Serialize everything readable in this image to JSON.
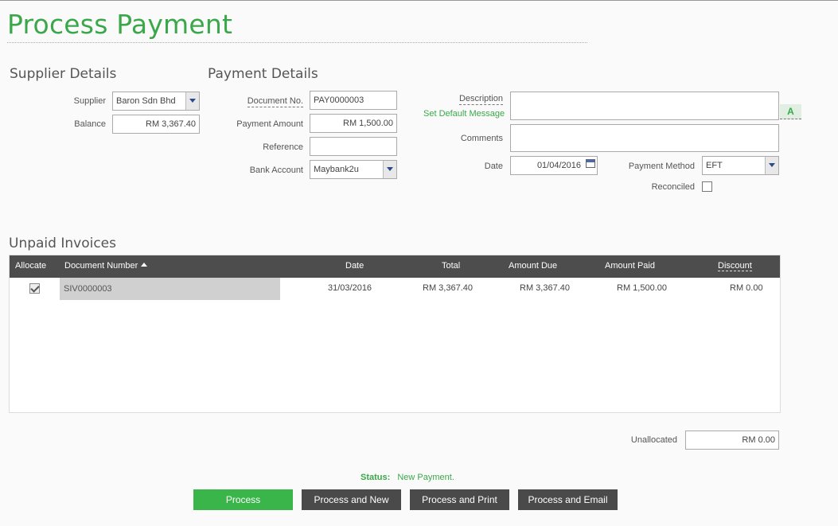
{
  "page": {
    "title": "Process Payment"
  },
  "supplier": {
    "heading": "Supplier Details",
    "supplier_label": "Supplier",
    "supplier_value": "Baron Sdn Bhd",
    "balance_label": "Balance",
    "balance_value": "RM 3,367.40"
  },
  "payment": {
    "heading": "Payment Details",
    "docno_label": "Document No.",
    "docno_value": "PAY0000003",
    "amount_label": "Payment Amount",
    "amount_value": "RM 1,500.00",
    "reference_label": "Reference",
    "reference_value": "",
    "bank_label": "Bank Account",
    "bank_value": "Maybank2u",
    "description_label": "Description",
    "set_default_link": "Set Default Message",
    "description_value": "",
    "comments_label": "Comments",
    "comments_value": "",
    "date_label": "Date",
    "date_value": "01/04/2016",
    "method_label": "Payment Method",
    "method_value": "EFT",
    "reconciled_label": "Reconciled",
    "a_icon": "A"
  },
  "invoices": {
    "heading": "Unpaid Invoices",
    "columns": [
      "Allocate",
      "Document Number",
      "Date",
      "Total",
      "Amount Due",
      "Amount Paid",
      "Discount"
    ],
    "rows": [
      {
        "allocate": true,
        "document_number": "SIV0000003",
        "date": "31/03/2016",
        "total": "RM 3,367.40",
        "amount_due": "RM 3,367.40",
        "amount_paid": "RM 1,500.00",
        "discount": "RM 0.00"
      }
    ]
  },
  "unallocated": {
    "label": "Unallocated",
    "value": "RM 0.00"
  },
  "status": {
    "label": "Status:",
    "value": "New Payment."
  },
  "buttons": {
    "process": "Process",
    "process_new": "Process and New",
    "process_print": "Process and Print",
    "process_email": "Process and Email"
  },
  "colors": {
    "accent": "#3aa84a",
    "header_bg": "#4d4d4d",
    "button_dark": "#4a4a4a"
  }
}
